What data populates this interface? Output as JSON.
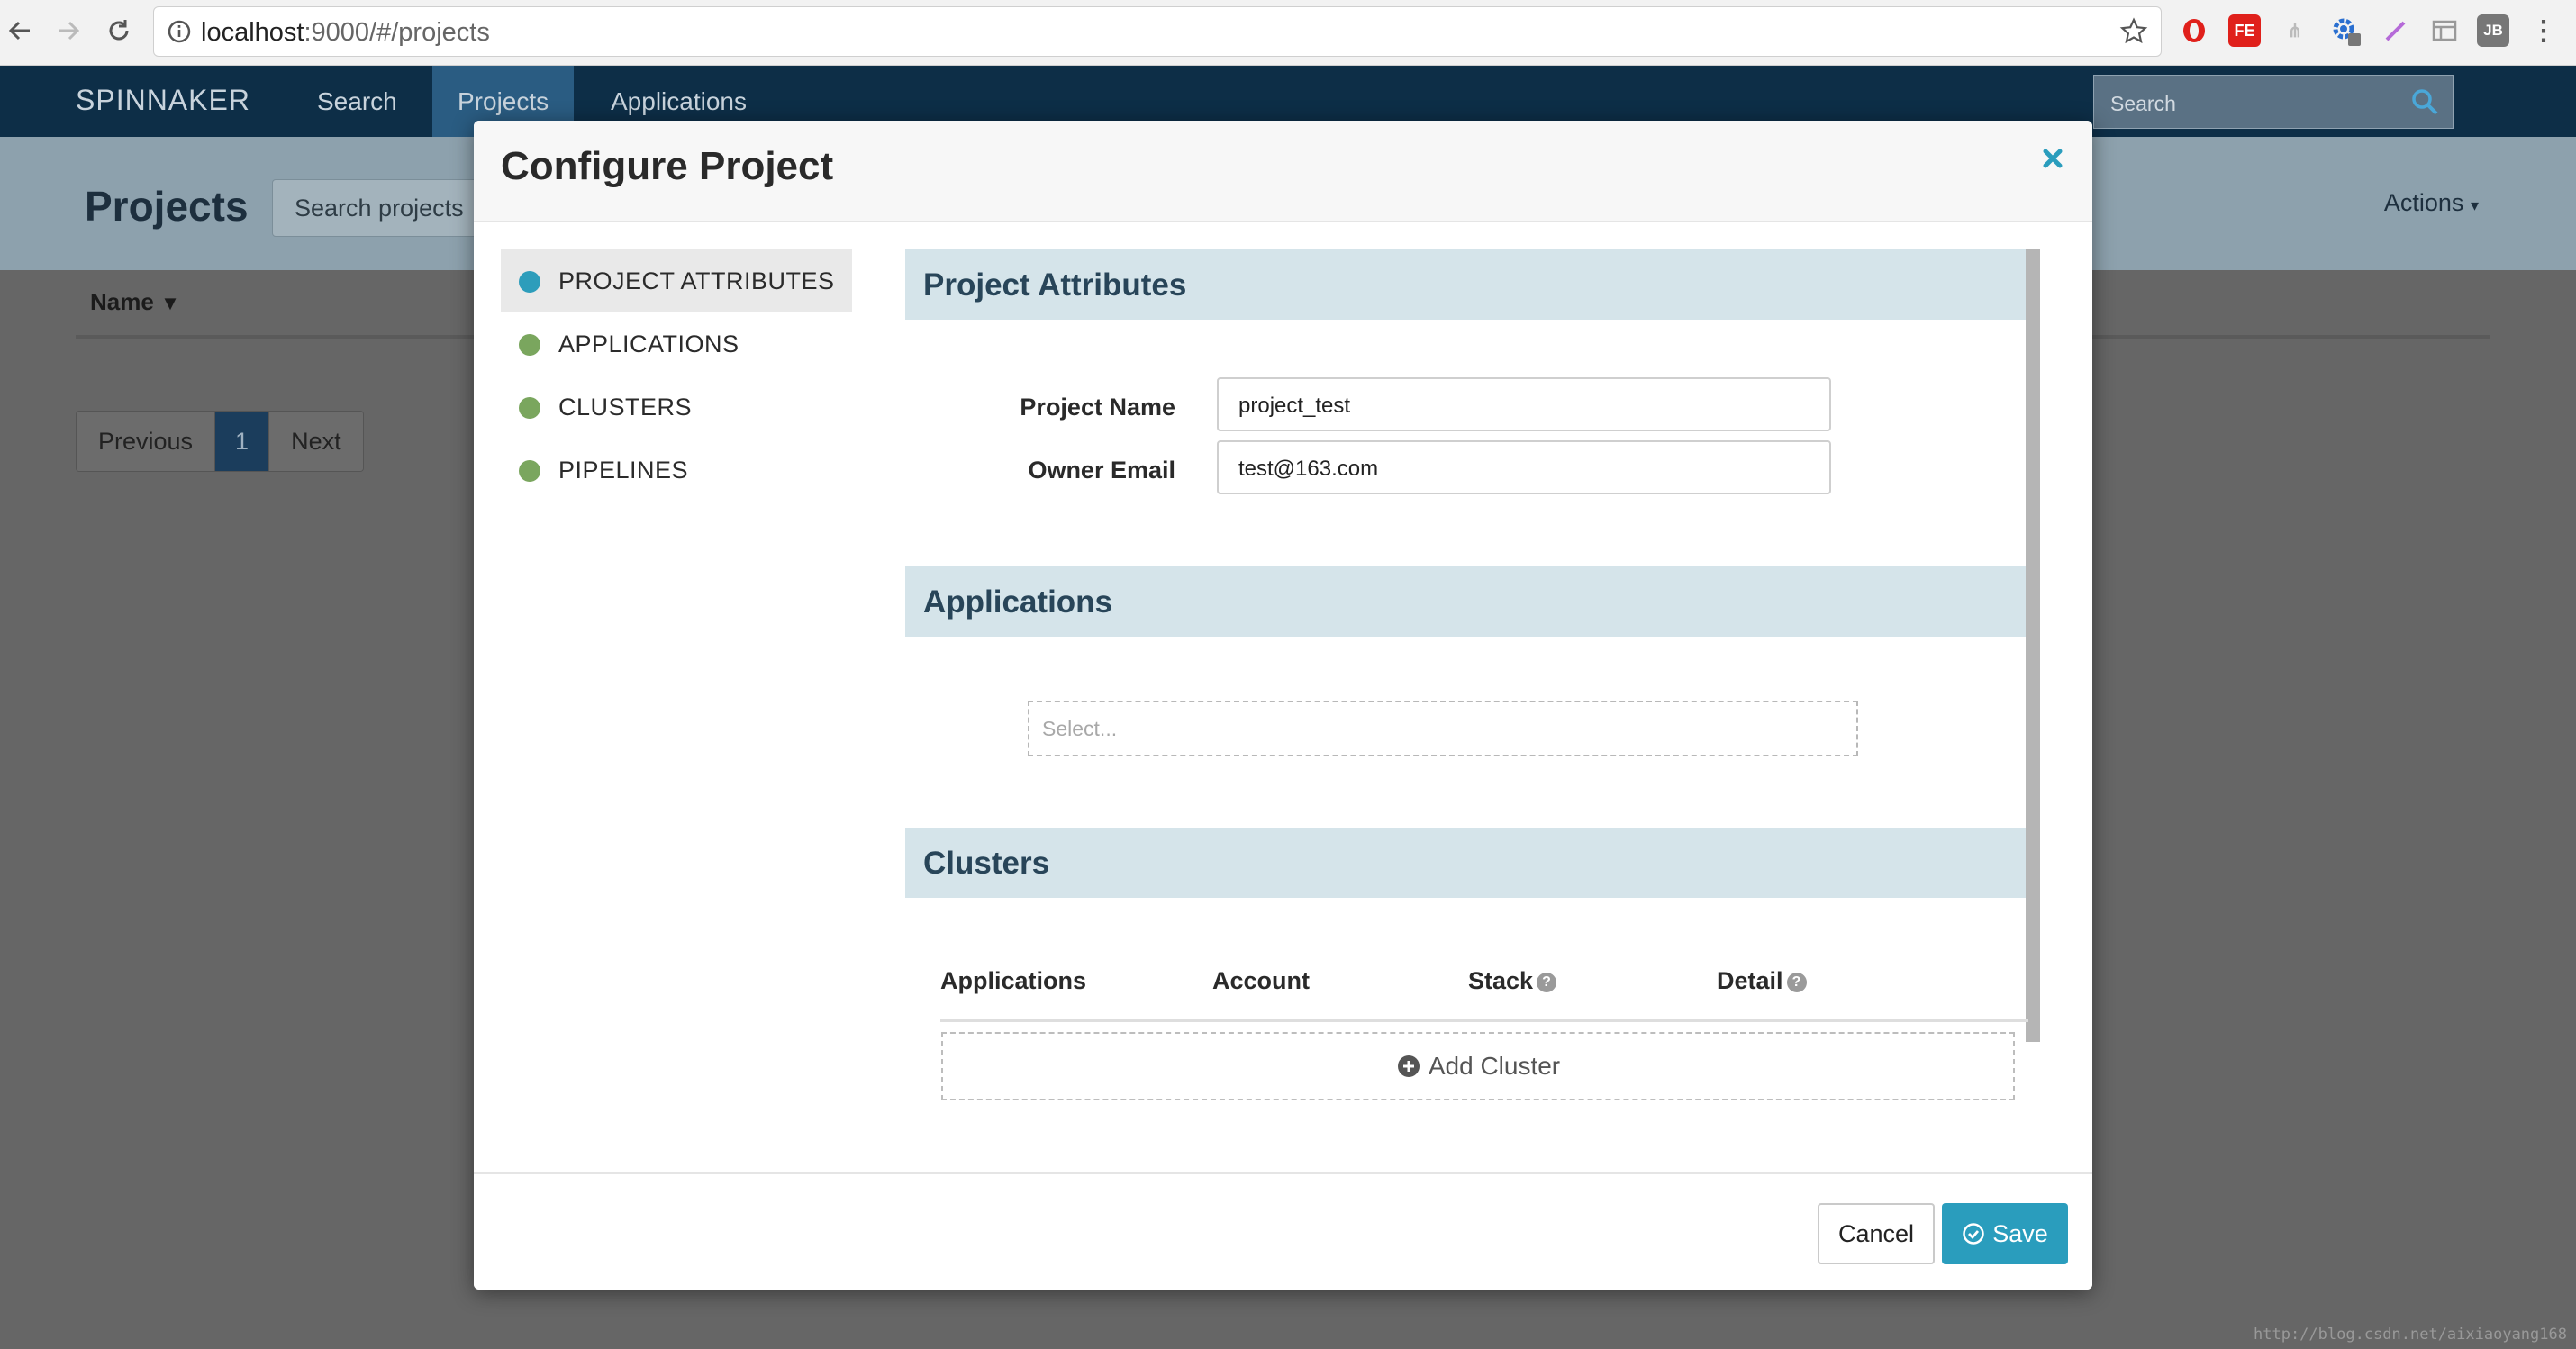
{
  "browser": {
    "url_host": "localhost",
    "url_path": ":9000/#/projects"
  },
  "app_nav": {
    "brand": "SPINNAKER",
    "links": [
      {
        "label": "Search",
        "active": false
      },
      {
        "label": "Projects",
        "active": true
      },
      {
        "label": "Applications",
        "active": false
      }
    ],
    "search_placeholder": "Search"
  },
  "page": {
    "title": "Projects",
    "search_placeholder": "Search projects",
    "actions_label": "Actions",
    "column_name": "Name",
    "pager": {
      "previous": "Previous",
      "current": "1",
      "next": "Next"
    },
    "watermark": "http://blog.csdn.net/aixiaoyang168"
  },
  "modal": {
    "title": "Configure Project",
    "side_nav": [
      {
        "label": "PROJECT ATTRIBUTES",
        "active": true
      },
      {
        "label": "APPLICATIONS",
        "active": false
      },
      {
        "label": "CLUSTERS",
        "active": false
      },
      {
        "label": "PIPELINES",
        "active": false
      }
    ],
    "attributes": {
      "section_title": "Project Attributes",
      "project_name_label": "Project Name",
      "project_name_value": "project_test",
      "owner_email_label": "Owner Email",
      "owner_email_value": "test@163.com"
    },
    "applications": {
      "section_title": "Applications",
      "select_placeholder": "Select..."
    },
    "clusters": {
      "section_title": "Clusters",
      "columns": [
        "Applications",
        "Account",
        "Stack",
        "Detail"
      ],
      "add_label": "Add Cluster"
    },
    "footer": {
      "cancel_label": "Cancel",
      "save_label": "Save"
    }
  },
  "colors": {
    "accent": "#2a9dbd",
    "nav_bg": "#0d2e47",
    "section_bg": "#d5e4ea",
    "dot_active": "#2d9dbb",
    "dot_inactive": "#7aa65e"
  }
}
